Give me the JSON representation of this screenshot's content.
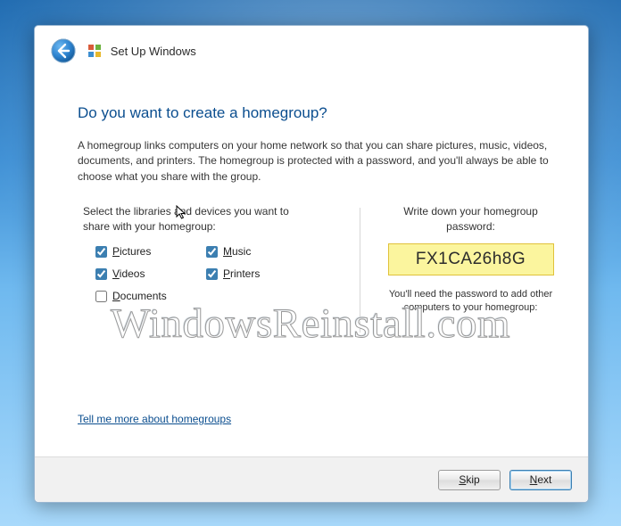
{
  "header": {
    "title": "Set Up Windows"
  },
  "main": {
    "heading": "Do you want to create a homegroup?",
    "description": "A homegroup links computers on your home network so that you can share pictures, music, videos, documents, and printers. The homegroup is protected with a password, and you'll always be able to choose what you share with the group.",
    "select_label": "Select the libraries and devices you want to share with your homegroup:",
    "checkboxes": {
      "pictures": {
        "label": "Pictures",
        "checked": true
      },
      "music": {
        "label": "Music",
        "checked": true
      },
      "videos": {
        "label": "Videos",
        "checked": true
      },
      "printers": {
        "label": "Printers",
        "checked": true
      },
      "documents": {
        "label": "Documents",
        "checked": false
      }
    },
    "write_label": "Write down your homegroup password:",
    "password": "FX1CA26h8G",
    "need_label": "You'll need the password to add other computers to your homegroup:",
    "link_text": "Tell me more about homegroups"
  },
  "footer": {
    "skip": "Skip",
    "next": "Next"
  },
  "watermark": "WindowsReinstall.com"
}
